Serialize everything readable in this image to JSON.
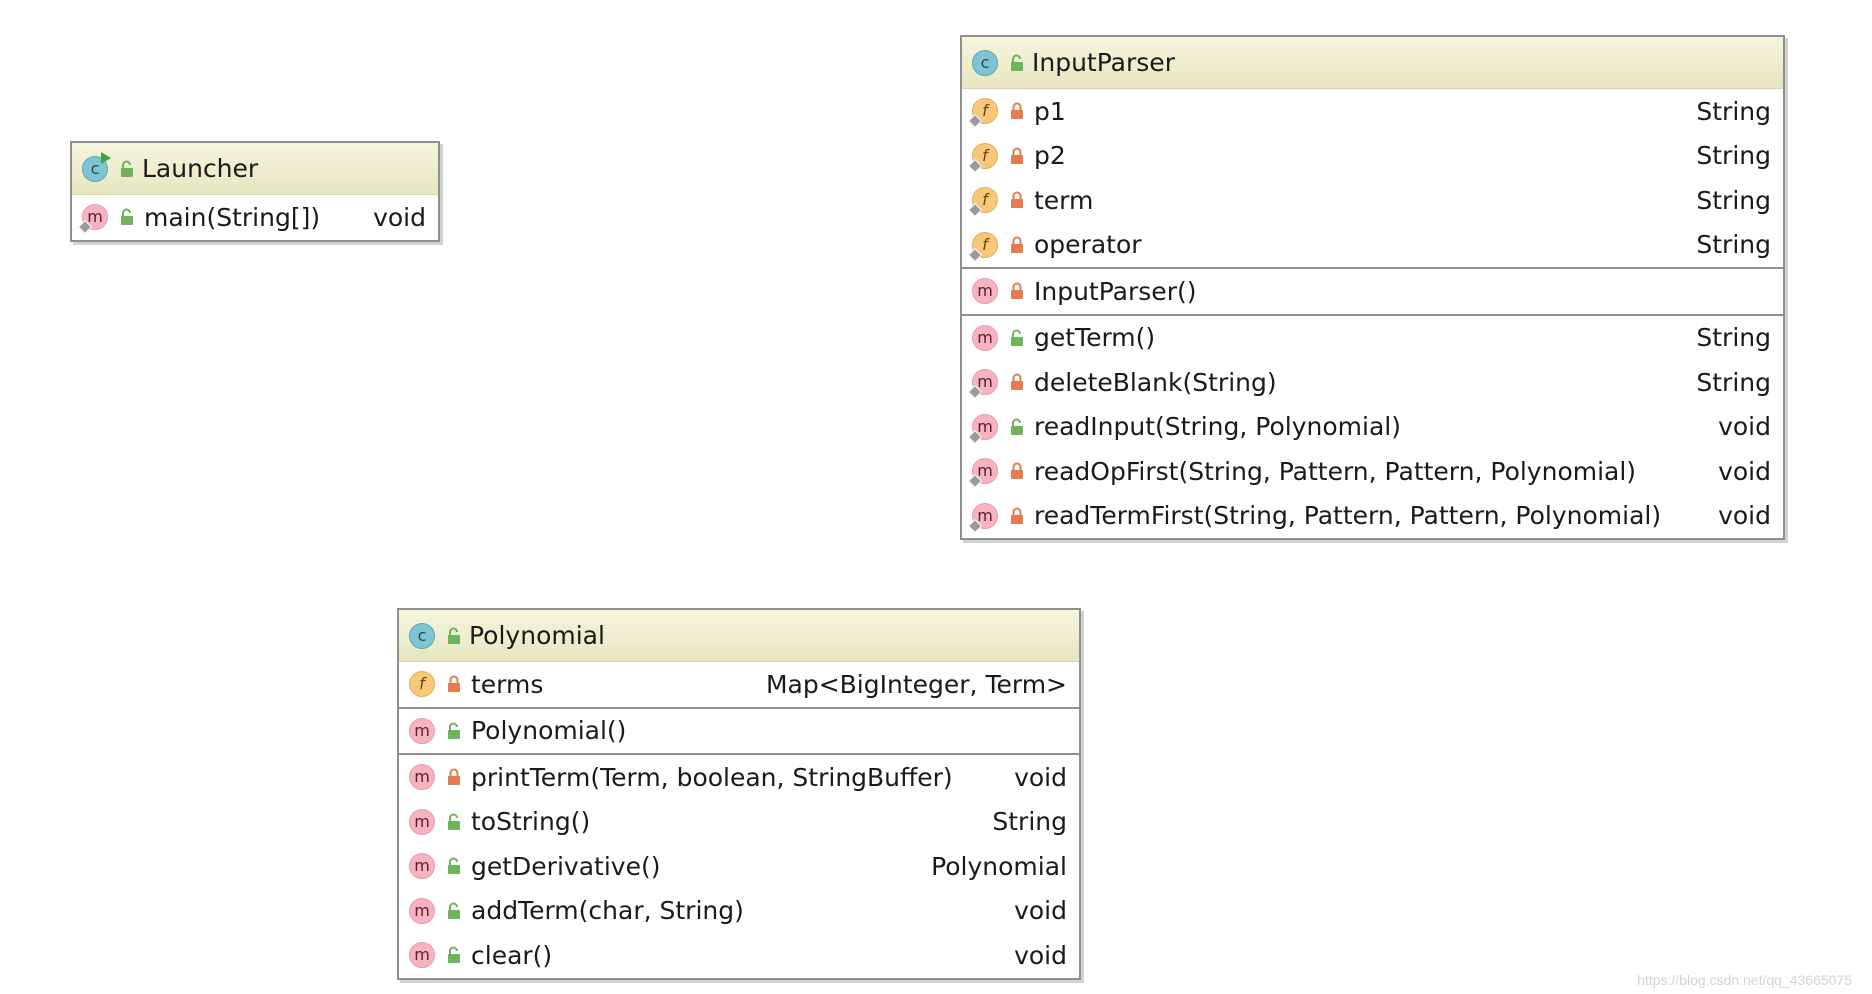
{
  "classes": [
    {
      "id": "launcher",
      "name": "Launcher",
      "runnable": true,
      "sections": [
        [
          {
            "kind": "method",
            "visibility": "public",
            "static": true,
            "name": "main(String[])",
            "type": "void"
          }
        ]
      ]
    },
    {
      "id": "inputparser",
      "name": "InputParser",
      "runnable": false,
      "sections": [
        [
          {
            "kind": "field",
            "visibility": "private",
            "static": true,
            "name": "p1",
            "type": "String"
          },
          {
            "kind": "field",
            "visibility": "private",
            "static": true,
            "name": "p2",
            "type": "String"
          },
          {
            "kind": "field",
            "visibility": "private",
            "static": true,
            "name": "term",
            "type": "String"
          },
          {
            "kind": "field",
            "visibility": "private",
            "static": true,
            "name": "operator",
            "type": "String"
          }
        ],
        [
          {
            "kind": "method",
            "visibility": "private",
            "static": false,
            "name": "InputParser()",
            "type": ""
          }
        ],
        [
          {
            "kind": "method",
            "visibility": "public",
            "static": false,
            "name": "getTerm()",
            "type": "String"
          },
          {
            "kind": "method",
            "visibility": "private",
            "static": true,
            "name": "deleteBlank(String)",
            "type": "String"
          },
          {
            "kind": "method",
            "visibility": "public",
            "static": true,
            "name": "readInput(String, Polynomial)",
            "type": "void"
          },
          {
            "kind": "method",
            "visibility": "private",
            "static": true,
            "name": "readOpFirst(String, Pattern, Pattern, Polynomial)",
            "type": "void"
          },
          {
            "kind": "method",
            "visibility": "private",
            "static": true,
            "name": "readTermFirst(String, Pattern, Pattern, Polynomial)",
            "type": "void"
          }
        ]
      ]
    },
    {
      "id": "polynomial",
      "name": "Polynomial",
      "runnable": false,
      "sections": [
        [
          {
            "kind": "field",
            "visibility": "private",
            "static": false,
            "name": "terms",
            "type": "Map<BigInteger, Term>"
          }
        ],
        [
          {
            "kind": "method",
            "visibility": "public",
            "static": false,
            "name": "Polynomial()",
            "type": ""
          }
        ],
        [
          {
            "kind": "method",
            "visibility": "private",
            "static": false,
            "name": "printTerm(Term, boolean, StringBuffer)",
            "type": "void"
          },
          {
            "kind": "method",
            "visibility": "public",
            "static": false,
            "name": "toString()",
            "type": "String"
          },
          {
            "kind": "method",
            "visibility": "public",
            "static": false,
            "name": "getDerivative()",
            "type": "Polynomial"
          },
          {
            "kind": "method",
            "visibility": "public",
            "static": false,
            "name": "addTerm(char, String)",
            "type": "void"
          },
          {
            "kind": "method",
            "visibility": "public",
            "static": false,
            "name": "clear()",
            "type": "void"
          }
        ]
      ]
    }
  ],
  "icons": {
    "class_letter": "c",
    "method_letter": "m",
    "field_letter": "f"
  },
  "colors": {
    "public_lock": "#6fb35a",
    "private_lock": "#e57b4f",
    "header_bg": "#f1f0d2",
    "border": "#8f8f8f"
  },
  "watermark": "https://blog.csdn.net/qq_43665075"
}
